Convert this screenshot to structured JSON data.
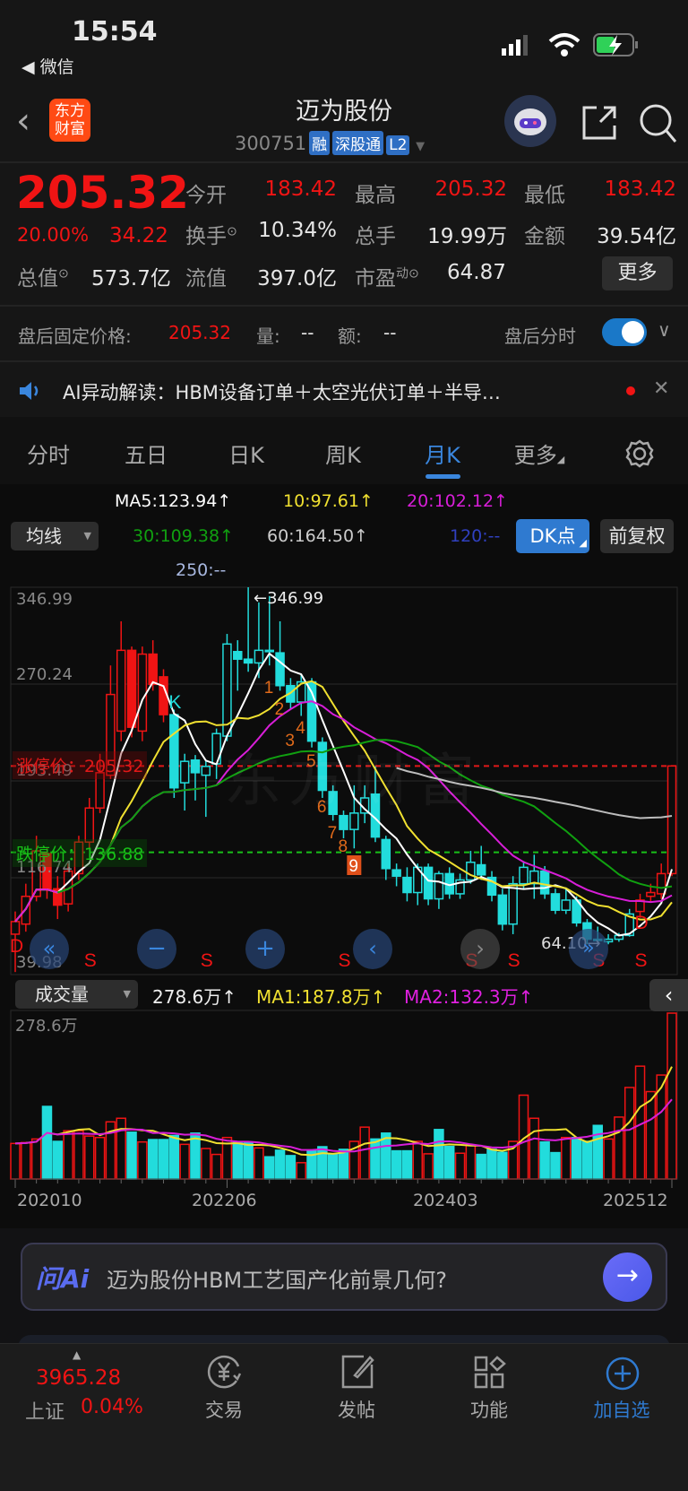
{
  "status": {
    "time": "15:54",
    "back_app": "微信"
  },
  "header": {
    "logo": "东方财富",
    "title": "迈为股份",
    "code": "300751",
    "tags": [
      "融",
      "深股通",
      "L2"
    ]
  },
  "quote": {
    "price": "205.32",
    "change_pct": "20.00%",
    "change": "34.22",
    "open_label": "今开",
    "open": "183.42",
    "high_label": "最高",
    "high": "205.32",
    "low_label": "最低",
    "low": "183.42",
    "turnover_label": "换手",
    "turnover": "10.34%",
    "volume_label": "总手",
    "volume": "19.99万",
    "amount_label": "金额",
    "amount": "39.54亿",
    "mktcap_label": "总值",
    "mktcap": "573.7亿",
    "float_label": "流值",
    "float": "397.0亿",
    "pe_label": "市盈",
    "pe_sup": "动",
    "pe": "64.87",
    "more": "更多"
  },
  "after_hours": {
    "label": "盘后固定价格:",
    "price": "205.32",
    "vol_label": "量:",
    "vol": "--",
    "amt_label": "额:",
    "amt": "--",
    "toggle_label": "盘后分时",
    "toggle_on": true
  },
  "ai_banner": {
    "text": "AI异动解读：HBM设备订单＋太空光伏订单＋半导…"
  },
  "tabs": [
    "分时",
    "五日",
    "日K",
    "周K",
    "月K",
    "更多"
  ],
  "active_tab": 4,
  "ma_legend": {
    "ma5": "MA5:123.94↑",
    "ma10": "10:97.61↑",
    "ma20": "20:102.12↑",
    "ma30": "30:109.38↑",
    "ma60": "60:164.50↑",
    "ma120": "120:--",
    "ma250": "250:--",
    "selector": "均线",
    "dk": "DK点",
    "adjust": "前复权"
  },
  "colors": {
    "up": "#f01414",
    "down": "#22dcdc",
    "ma5": "#ffffff",
    "ma10": "#f0e030",
    "ma20": "#d81ed8",
    "ma30": "#10a010",
    "ma60": "#bdbdbd",
    "accent": "#2f7ad0"
  },
  "chart_data": {
    "type": "candlestick",
    "period": "monthly",
    "y_ticks": [
      "346.99",
      "270.24",
      "193.49",
      "116.74",
      "39.98"
    ],
    "ylim": [
      39.98,
      346.99
    ],
    "x_ticks": [
      {
        "i": 0,
        "label": "202010"
      },
      {
        "i": 20,
        "label": "202206"
      },
      {
        "i": 41,
        "label": "202403"
      },
      {
        "i": 62,
        "label": "202512"
      }
    ],
    "limit_up": {
      "label": "涨停价：205.32",
      "value": 205.32
    },
    "limit_down": {
      "label": "跌停价：136.88",
      "value": 136.88
    },
    "max_label": "←346.99",
    "min_label": "64.10→",
    "watermark": "东方财富",
    "candles": [
      [
        72,
        90,
        42,
        82,
        "u"
      ],
      [
        80,
        112,
        74,
        102,
        "u"
      ],
      [
        102,
        150,
        98,
        138,
        "u"
      ],
      [
        136,
        140,
        100,
        108,
        "f"
      ],
      [
        108,
        118,
        84,
        95,
        "f"
      ],
      [
        96,
        128,
        90,
        122,
        "u"
      ],
      [
        120,
        150,
        115,
        145,
        "u"
      ],
      [
        145,
        180,
        140,
        172,
        "u"
      ],
      [
        172,
        215,
        168,
        200,
        "u"
      ],
      [
        198,
        285,
        195,
        262,
        "u"
      ],
      [
        233,
        320,
        225,
        297,
        "u"
      ],
      [
        297,
        300,
        228,
        236,
        "f"
      ],
      [
        233,
        300,
        225,
        294,
        "u"
      ],
      [
        294,
        305,
        265,
        270,
        "f"
      ],
      [
        276,
        282,
        240,
        246,
        "f"
      ],
      [
        246,
        250,
        180,
        188,
        "d"
      ],
      [
        192,
        215,
        170,
        209,
        "h"
      ],
      [
        210,
        214,
        178,
        200,
        "d"
      ],
      [
        198,
        210,
        165,
        205,
        "h"
      ],
      [
        207,
        235,
        195,
        231,
        "h"
      ],
      [
        229,
        310,
        225,
        302,
        "h"
      ],
      [
        296,
        305,
        265,
        290,
        "d"
      ],
      [
        290,
        346.99,
        280,
        287,
        "d"
      ],
      [
        287,
        335,
        275,
        297,
        "h"
      ],
      [
        297,
        340,
        285,
        296,
        "d"
      ],
      [
        295,
        320,
        265,
        269,
        "d"
      ],
      [
        269,
        275,
        250,
        256,
        "d"
      ],
      [
        256,
        278,
        245,
        272,
        "h"
      ],
      [
        272,
        275,
        220,
        225,
        "d"
      ],
      [
        224,
        228,
        180,
        186,
        "d"
      ],
      [
        185,
        190,
        162,
        167,
        "d"
      ],
      [
        166,
        170,
        148,
        155,
        "d"
      ],
      [
        155,
        190,
        140,
        168,
        "h"
      ],
      [
        168,
        190,
        160,
        180,
        "h"
      ],
      [
        183,
        205,
        145,
        149,
        "d"
      ],
      [
        147,
        150,
        115,
        124,
        "d"
      ],
      [
        123,
        128,
        110,
        118,
        "d"
      ],
      [
        117,
        125,
        98,
        105,
        "d"
      ],
      [
        105,
        128,
        95,
        125,
        "h"
      ],
      [
        125,
        128,
        95,
        100,
        "d"
      ],
      [
        100,
        122,
        92,
        120,
        "h"
      ],
      [
        120,
        125,
        100,
        104,
        "d"
      ],
      [
        104,
        120,
        100,
        115,
        "h"
      ],
      [
        115,
        138,
        112,
        129,
        "h"
      ],
      [
        127,
        142,
        115,
        119,
        "d"
      ],
      [
        117,
        122,
        98,
        103,
        "d"
      ],
      [
        103,
        108,
        75,
        80,
        "d"
      ],
      [
        80,
        118,
        72,
        112,
        "h"
      ],
      [
        112,
        130,
        108,
        125,
        "h"
      ],
      [
        112,
        135,
        100,
        122,
        "h"
      ],
      [
        122,
        126,
        100,
        104,
        "d"
      ],
      [
        104,
        108,
        88,
        91,
        "d"
      ],
      [
        91,
        108,
        88,
        99,
        "h"
      ],
      [
        99,
        102,
        78,
        81,
        "d"
      ],
      [
        81,
        84,
        64,
        68,
        "d"
      ],
      [
        68,
        78,
        64.1,
        67,
        "d"
      ],
      [
        66,
        72,
        64,
        68,
        "h"
      ],
      [
        68,
        73,
        66,
        71,
        "h"
      ],
      [
        71,
        92,
        70,
        88,
        "h"
      ],
      [
        90,
        104,
        85,
        99,
        "u"
      ],
      [
        102,
        112,
        98,
        105,
        "u"
      ],
      [
        104,
        128,
        100,
        120,
        "u"
      ],
      [
        120,
        205.32,
        118,
        205.32,
        "u"
      ]
    ],
    "signals": [
      {
        "i": 0,
        "t": "D"
      },
      {
        "i": 7,
        "t": "S"
      },
      {
        "i": 15,
        "t": "K"
      },
      {
        "i": 18,
        "t": "S"
      },
      {
        "i": 31,
        "t": "S"
      },
      {
        "i": 43,
        "t": "S"
      },
      {
        "i": 47,
        "t": "S"
      },
      {
        "i": 55,
        "t": "S"
      },
      {
        "i": 59,
        "t": "S"
      },
      {
        "i": 59,
        "t": "D"
      }
    ],
    "td_count": [
      {
        "i": 24,
        "n": "1"
      },
      {
        "i": 25,
        "n": "2"
      },
      {
        "i": 26,
        "n": "3"
      },
      {
        "i": 27,
        "n": "4"
      },
      {
        "i": 28,
        "n": "5"
      },
      {
        "i": 29,
        "n": "6"
      },
      {
        "i": 30,
        "n": "7"
      },
      {
        "i": 31,
        "n": "8"
      },
      {
        "i": 32,
        "n": "9"
      }
    ],
    "volume": {
      "selector": "成交量",
      "value_label": "278.6万↑",
      "ma1_label": "MA1:187.8万↑",
      "ma2_label": "MA2:132.3万↑",
      "max_label": "278.6万",
      "unit": "万",
      "values": [
        59.7,
        61.2,
        67.2,
        121.9,
        63.2,
        81.1,
        81.1,
        72.1,
        69.7,
        96.0,
        102.0,
        78.6,
        62.2,
        66.2,
        66.2,
        73.1,
        58.2,
        77.1,
        51.2,
        41.3,
        69.7,
        62.2,
        61.2,
        52.2,
        37.3,
        48.3,
        39.3,
        27.4,
        48.3,
        54.2,
        42.3,
        49.8,
        63.2,
        87.1,
        67.2,
        77.1,
        47.3,
        47.3,
        63.2,
        42.3,
        83.1,
        54.7,
        43.3,
        57.2,
        41.3,
        49.8,
        44.8,
        63.2,
        140.8,
        102.0,
        62.2,
        44.3,
        69.7,
        69.7,
        63.2,
        90.0,
        67.2,
        104.0,
        153.7,
        189.5,
        146.8,
        174.6,
        278.6
      ],
      "down_bars": [
        3,
        4,
        11,
        13,
        14,
        15,
        17,
        21,
        22,
        24,
        25,
        26,
        28,
        29,
        30,
        31,
        34,
        35,
        36,
        37,
        40,
        41,
        44,
        45,
        46,
        50,
        51,
        53,
        54,
        55
      ]
    }
  },
  "ask_ai": {
    "logo": "问Ai",
    "prompt": "迈为股份HBM工艺国产化前景几何?"
  },
  "bottom_nav": {
    "index_value": "3965.28",
    "index_name": "上证",
    "index_pct": "0.04%",
    "items": [
      "交易",
      "发帖",
      "功能",
      "加自选"
    ]
  }
}
